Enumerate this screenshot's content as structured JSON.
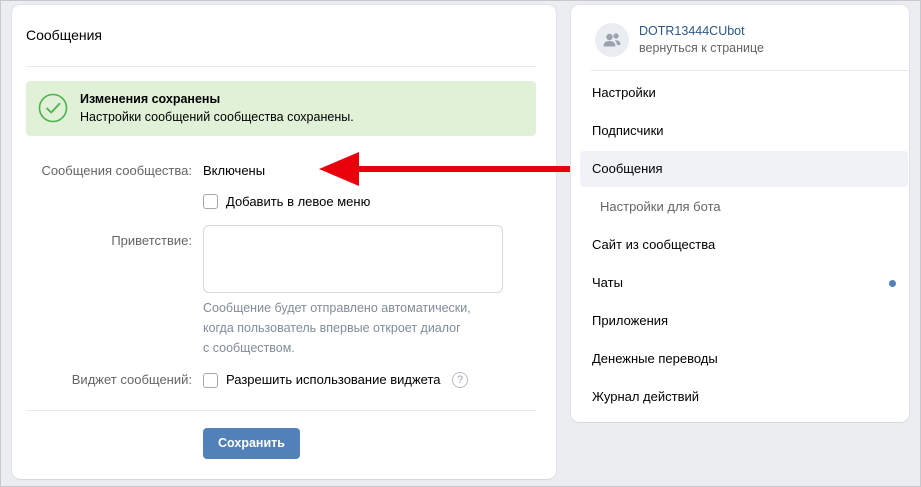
{
  "main": {
    "title": "Сообщения",
    "alert": {
      "title": "Изменения сохранены",
      "text": "Настройки сообщений сообщества сохранены."
    },
    "messages_label": "Сообщения сообщества:",
    "messages_value": "Включены",
    "add_left_menu_label": "Добавить в левое меню",
    "greeting_label": "Приветствие:",
    "greeting_value": "",
    "greeting_hint_lines": [
      "Сообщение будет отправлено автоматически,",
      "когда пользователь впервые откроет диалог",
      "с сообществом."
    ],
    "widget_label": "Виджет сообщений:",
    "widget_checkbox_label": "Разрешить использование виджета",
    "help_icon_glyph": "?",
    "save_label": "Сохранить"
  },
  "sidebar": {
    "group_name": "DOTR13444CUbot",
    "back_link": "вернуться к странице",
    "items": [
      {
        "label": "Настройки"
      },
      {
        "label": "Подписчики"
      },
      {
        "label": "Сообщения",
        "active": true
      },
      {
        "label": "Настройки для бота",
        "sub": true
      },
      {
        "label": "Сайт из сообщества"
      },
      {
        "label": "Чаты",
        "dot": true
      },
      {
        "label": "Приложения"
      },
      {
        "label": "Денежные переводы"
      },
      {
        "label": "Журнал действий"
      }
    ]
  },
  "colors": {
    "accent": "#5181b8",
    "success_bg": "#e0f1d8",
    "success_icon": "#4bb34b",
    "arrow": "#e8000b"
  },
  "icons": {
    "alert": "check-circle-icon",
    "avatar": "users-icon",
    "help": "question-icon",
    "arrow": "arrow-left-annotation"
  }
}
